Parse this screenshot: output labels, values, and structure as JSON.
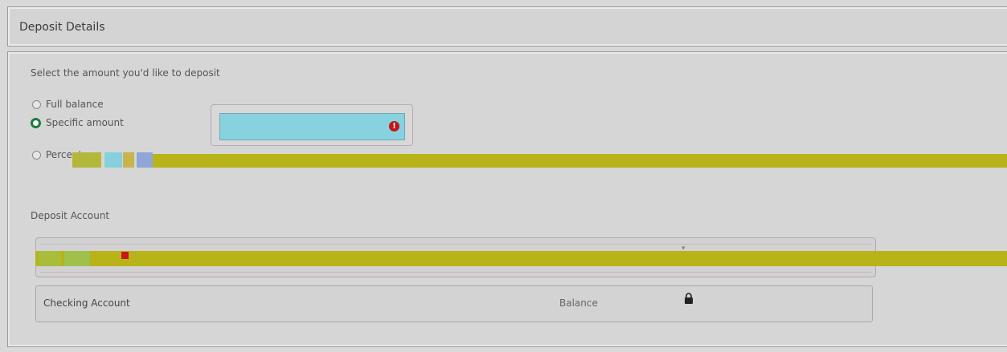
{
  "header": {
    "title": "Deposit Details"
  },
  "deposit": {
    "prompt": "Select the amount you'd like to deposit",
    "options": [
      {
        "label": "Full balance",
        "selected": false
      },
      {
        "label": "Specific amount",
        "selected": true
      },
      {
        "label": "Percentage",
        "selected": false
      }
    ],
    "amount_value": "",
    "error_symbol": "!"
  },
  "source": {
    "label": "Deposit Account",
    "account_name": "Checking Account",
    "balance_label": "Balance"
  },
  "colors": {
    "highlight": "#b8b318",
    "input_fill": "#88d2e0",
    "selected_radio": "#1e7a3c",
    "error": "#c01818"
  }
}
